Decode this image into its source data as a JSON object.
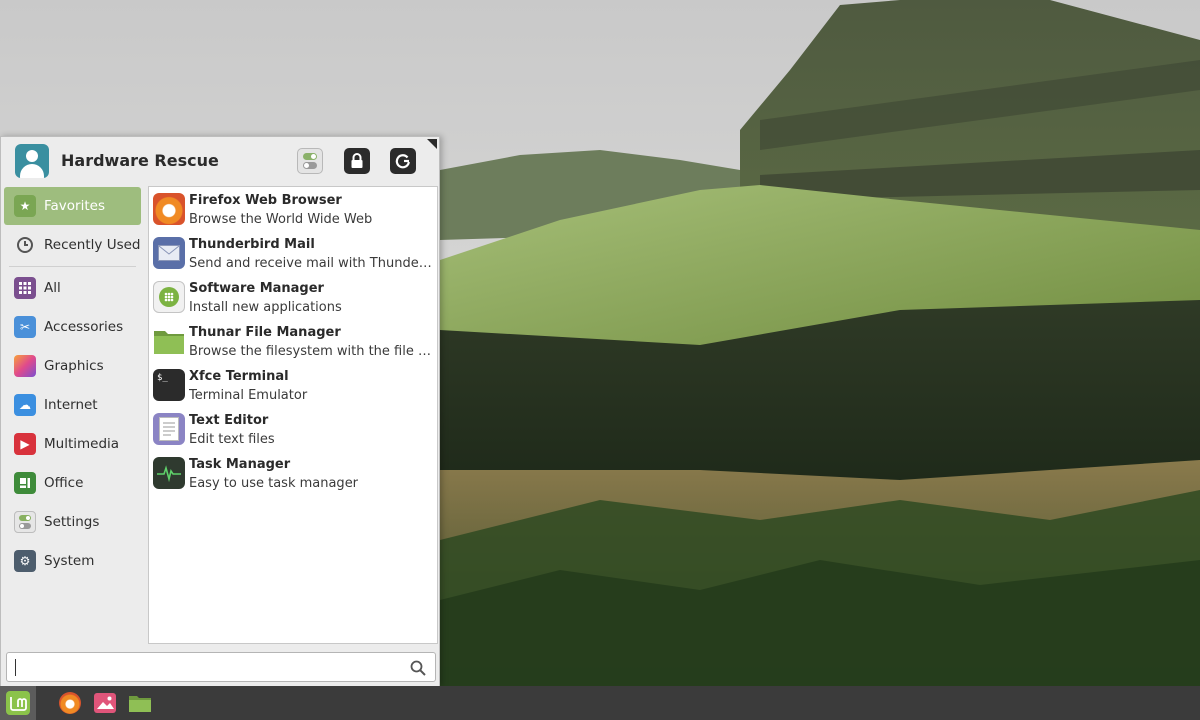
{
  "user": {
    "name": "Hardware Rescue",
    "avatar_icon": "user-avatar-icon"
  },
  "header_buttons": [
    {
      "name": "settings-toggle-button",
      "icon": "toggle-icon"
    },
    {
      "name": "lock-screen-button",
      "icon": "lock-icon"
    },
    {
      "name": "logout-button",
      "icon": "power-icon"
    }
  ],
  "categories": [
    {
      "label": "Favorites",
      "icon": "star-folder-icon",
      "active": true,
      "color": "#7aa653"
    },
    {
      "label": "Recently Used",
      "icon": "clock-icon",
      "color": "#555555"
    },
    {
      "label": "All",
      "icon": "grid-icon",
      "color": "#7b4f8f"
    },
    {
      "label": "Accessories",
      "icon": "scissors-icon",
      "color": "#4a90d9"
    },
    {
      "label": "Graphics",
      "icon": "graphics-icon",
      "color": "#e04a8c"
    },
    {
      "label": "Internet",
      "icon": "cloud-icon",
      "color": "#3b8fe0"
    },
    {
      "label": "Multimedia",
      "icon": "play-icon",
      "color": "#d8323c"
    },
    {
      "label": "Office",
      "icon": "office-icon",
      "color": "#3e8b3a"
    },
    {
      "label": "Settings",
      "icon": "toggles-icon",
      "color": "#88b060"
    },
    {
      "label": "System",
      "icon": "gear-icon",
      "color": "#4d5d6d"
    }
  ],
  "apps": [
    {
      "name": "Firefox Web Browser",
      "desc": "Browse the World Wide Web",
      "icon": "firefox-icon"
    },
    {
      "name": "Thunderbird Mail",
      "desc": "Send and receive mail with Thunderbird",
      "icon": "mail-icon"
    },
    {
      "name": "Software Manager",
      "desc": "Install new applications",
      "icon": "software-manager-icon"
    },
    {
      "name": "Thunar File Manager",
      "desc": "Browse the filesystem with the file ma...",
      "icon": "folder-icon"
    },
    {
      "name": "Xfce Terminal",
      "desc": "Terminal Emulator",
      "icon": "terminal-icon"
    },
    {
      "name": "Text Editor",
      "desc": "Edit text files",
      "icon": "text-editor-icon"
    },
    {
      "name": "Task Manager",
      "desc": "Easy to use task manager",
      "icon": "task-manager-icon"
    }
  ],
  "search": {
    "value": "",
    "placeholder": ""
  },
  "taskbar": [
    {
      "name": "mint-menu-button",
      "icon": "mint-logo-icon"
    },
    {
      "name": "taskbar-firefox",
      "icon": "firefox-icon"
    },
    {
      "name": "taskbar-image-viewer",
      "icon": "image-icon"
    },
    {
      "name": "taskbar-files",
      "icon": "folder-icon"
    }
  ],
  "colors": {
    "accent": "#9ebd7e",
    "taskbar": "#3b3b3b",
    "panel": "#ececec"
  }
}
